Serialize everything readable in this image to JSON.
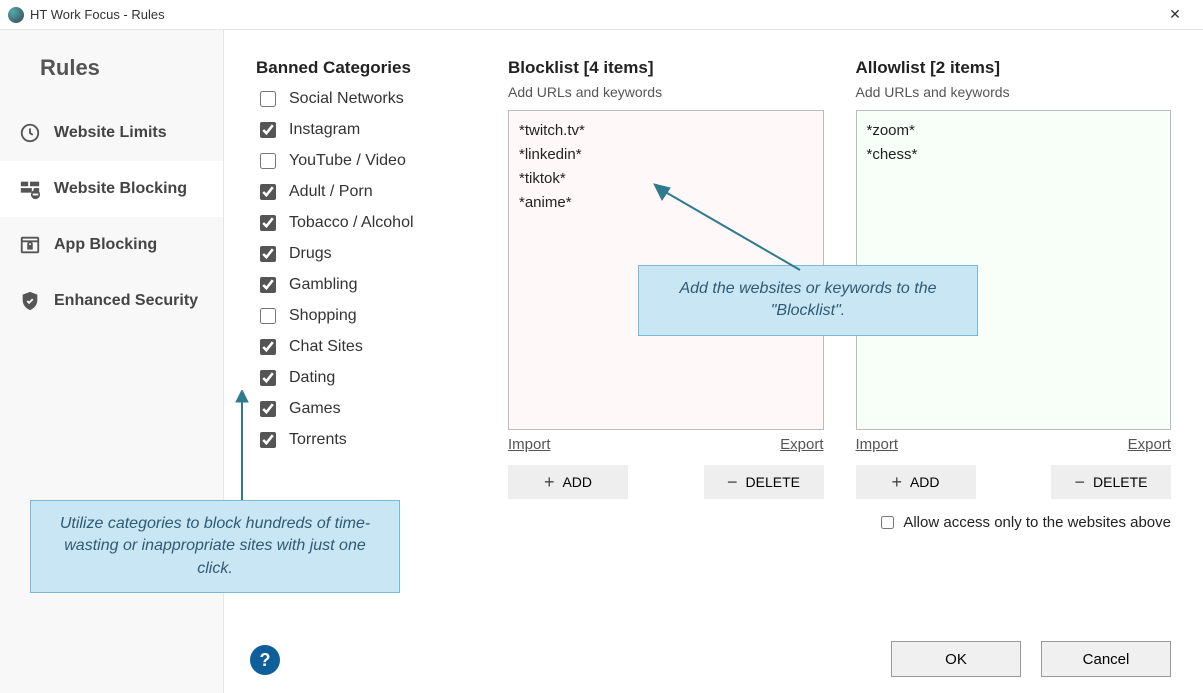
{
  "window": {
    "title": "HT Work Focus - Rules"
  },
  "sidebar": {
    "heading": "Rules",
    "items": [
      {
        "label": "Website Limits"
      },
      {
        "label": "Website Blocking"
      },
      {
        "label": "App Blocking"
      },
      {
        "label": "Enhanced Security"
      }
    ]
  },
  "categories": {
    "title": "Banned Categories",
    "items": [
      {
        "label": "Social Networks",
        "checked": false
      },
      {
        "label": "Instagram",
        "checked": true
      },
      {
        "label": "YouTube / Video",
        "checked": false
      },
      {
        "label": "Adult / Porn",
        "checked": true
      },
      {
        "label": "Tobacco / Alcohol",
        "checked": true
      },
      {
        "label": "Drugs",
        "checked": true
      },
      {
        "label": "Gambling",
        "checked": true
      },
      {
        "label": "Shopping",
        "checked": false
      },
      {
        "label": "Chat Sites",
        "checked": true
      },
      {
        "label": "Dating",
        "checked": true
      },
      {
        "label": "Games",
        "checked": true
      },
      {
        "label": "Torrents",
        "checked": true
      }
    ]
  },
  "blocklist": {
    "title": "Blocklist [4 items]",
    "sub": "Add URLs and keywords",
    "items": [
      "*twitch.tv*",
      "*linkedin*",
      "*tiktok*",
      "*anime*"
    ],
    "import": "Import",
    "export": "Export",
    "add": "ADD",
    "delete": "DELETE"
  },
  "allowlist": {
    "title": "Allowlist [2 items]",
    "sub": "Add URLs and keywords",
    "items": [
      "*zoom*",
      "*chess*"
    ],
    "import": "Import",
    "export": "Export",
    "add": "ADD",
    "delete": "DELETE",
    "allow_only_label": "Allow access only to the websites above",
    "allow_only_checked": false
  },
  "footer": {
    "ok": "OK",
    "cancel": "Cancel"
  },
  "callouts": {
    "cat": "Utilize categories to block hundreds of time-wasting or inappropriate sites with just one click.",
    "block": "Add the websites or keywords to the \"Blocklist\"."
  },
  "help": "?"
}
